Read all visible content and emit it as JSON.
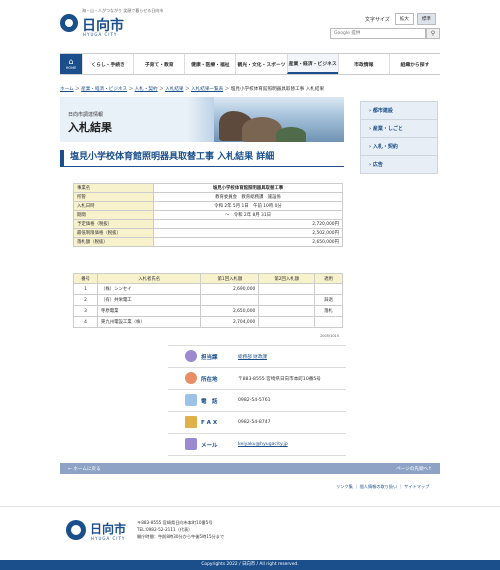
{
  "header": {
    "tagline": "海・山・人がつながり 笑顔で暮らせる日向市",
    "logo_name": "日向市",
    "logo_sub": "HYUGA CITY",
    "fontsize_label": "文字サイズ",
    "fontsize_large": "拡大",
    "fontsize_normal": "標準",
    "search_placeholder": "Google 提供"
  },
  "gnav": {
    "home_label": "HOME",
    "items": [
      "くらし・手続き",
      "子育て・教育",
      "健康・医療・福祉",
      "観光・文化・スポーツ",
      "産業・経済・ビジネス",
      "市政情報",
      "組織から探す"
    ]
  },
  "breadcrumb": {
    "items": [
      "ホーム",
      "産業・経済・ビジネス",
      "入札・契約",
      "入札結果",
      "入札結果一覧表"
    ],
    "current": "塩見小学校体育館照明器具取替工事 入札結果"
  },
  "banner": {
    "subtitle": "日向市調達情報",
    "title": "入札結果"
  },
  "sidenav": {
    "items": [
      "都市建設",
      "産業・しごと",
      "入札・契約",
      "広告"
    ]
  },
  "page_title": "塩見小学校体育館照明器具取替工事 入札結果 詳細",
  "info_table": {
    "rows": [
      {
        "label": "事業名",
        "value": "塩見小学校体育館照明器具取替工事"
      },
      {
        "label": "所管",
        "value": "教育委員会　教育総務課　施設係"
      },
      {
        "label": "入札日時",
        "value": "令和 2年 5月 1日　午前 10時 0分"
      },
      {
        "label": "期間",
        "value": "〜　令和 2年 8月 31日"
      },
      {
        "label": "予定価格（税抜）",
        "value": "2,720,000円"
      },
      {
        "label": "最低制限価格（税抜）",
        "value": "2,502,000円"
      },
      {
        "label": "落札額（税抜）",
        "value": "2,650,000円"
      }
    ]
  },
  "bidders_table": {
    "headers": [
      "番号",
      "入札者氏名",
      "第1回入札額",
      "第2回入札額",
      "適用"
    ],
    "rows": [
      [
        "1",
        "（株）シンセイ",
        "2,690,000",
        "",
        ""
      ],
      [
        "2",
        "（有）共栄電工",
        "",
        "",
        "辞退"
      ],
      [
        "3",
        "寺原電業",
        "2,650,000",
        "",
        "落札"
      ],
      [
        "4",
        "東九州電設工業（株）",
        "2,704,000",
        "",
        ""
      ]
    ],
    "date_note": "2005/1015"
  },
  "contact": {
    "dept_label": "担当課",
    "dept_value": "総務部 財政課",
    "address_label": "所在地",
    "address_value": "〒883-8555 宮崎県日向市本町10番5号",
    "tel_label": "電　話",
    "tel_value": "0982-54-5761",
    "fax_label": "F A X",
    "fax_value": "0982-54-8747",
    "mail_label": "メール",
    "mail_value": "keiyaku@hyugacity.jp"
  },
  "pager": {
    "prev": "← ホームに戻る",
    "next": "ページの先頭へ↑"
  },
  "footer_links": "リンク集 ｜ 個人情報の取り扱い ｜ サイトマップ",
  "footer": {
    "logo_name": "日向市",
    "logo_sub": "HYUGA CITY",
    "address": "〒883-8555 宮崎県日向市本町10番5号",
    "tel": "TEL:0982-52-2111（代表）",
    "hours": "開庁時間：午前8時30分から午後5時15分まで"
  },
  "copyright": "Copyrights 2022 / 日向市 / All right reserved."
}
